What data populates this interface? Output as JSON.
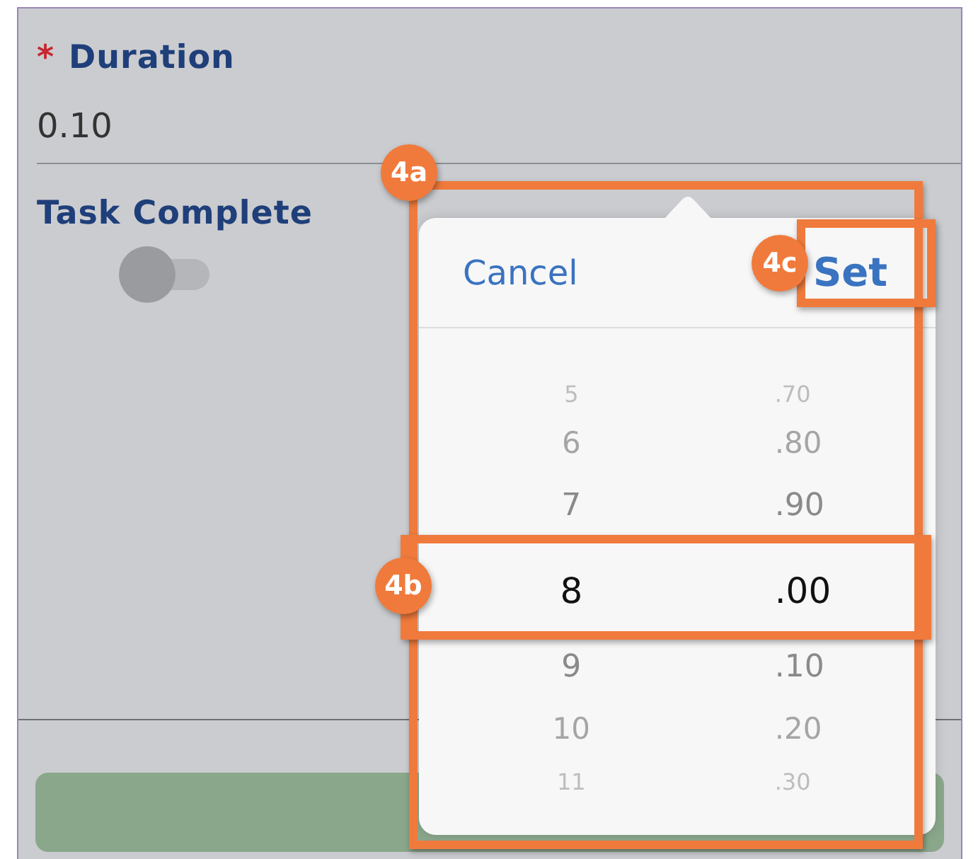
{
  "form": {
    "fields": [
      {
        "kind": "number",
        "label": "Duration",
        "required_mark": "*",
        "value": "0.10"
      },
      {
        "kind": "toggle",
        "label": "Task Complete",
        "on": false
      }
    ]
  },
  "picker": {
    "cancel": "Cancel",
    "confirm": "Set",
    "rows": [
      {
        "whole": "5",
        "fraction": ".70",
        "selected": false
      },
      {
        "whole": "6",
        "fraction": ".80",
        "selected": false
      },
      {
        "whole": "7",
        "fraction": ".90",
        "selected": false
      },
      {
        "whole": "8",
        "fraction": ".00",
        "selected": true
      },
      {
        "whole": "9",
        "fraction": ".10",
        "selected": false
      },
      {
        "whole": "10",
        "fraction": ".20",
        "selected": false
      },
      {
        "whole": "11",
        "fraction": ".30",
        "selected": false
      }
    ]
  },
  "callouts": {
    "picker": "4a",
    "selected_row": "4b",
    "set_button": "4c"
  }
}
